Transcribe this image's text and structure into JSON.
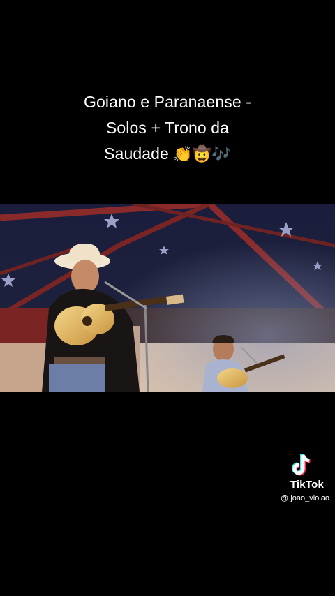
{
  "caption": {
    "line1": "Goiano e Paranaense -",
    "line2": "Solos + Trono da",
    "line3_text": "Saudade",
    "line3_emojis": "👏🤠🎶"
  },
  "watermark": {
    "brand": "TikTok",
    "handle": "@ joao_violao",
    "icon": "tiktok-note-icon"
  },
  "video": {
    "scene": "two-singers-with-guitars-on-stage"
  },
  "colors": {
    "background": "#000000",
    "text": "#ffffff",
    "tiktok_cyan": "#25f4ee",
    "tiktok_red": "#fe2c55"
  }
}
